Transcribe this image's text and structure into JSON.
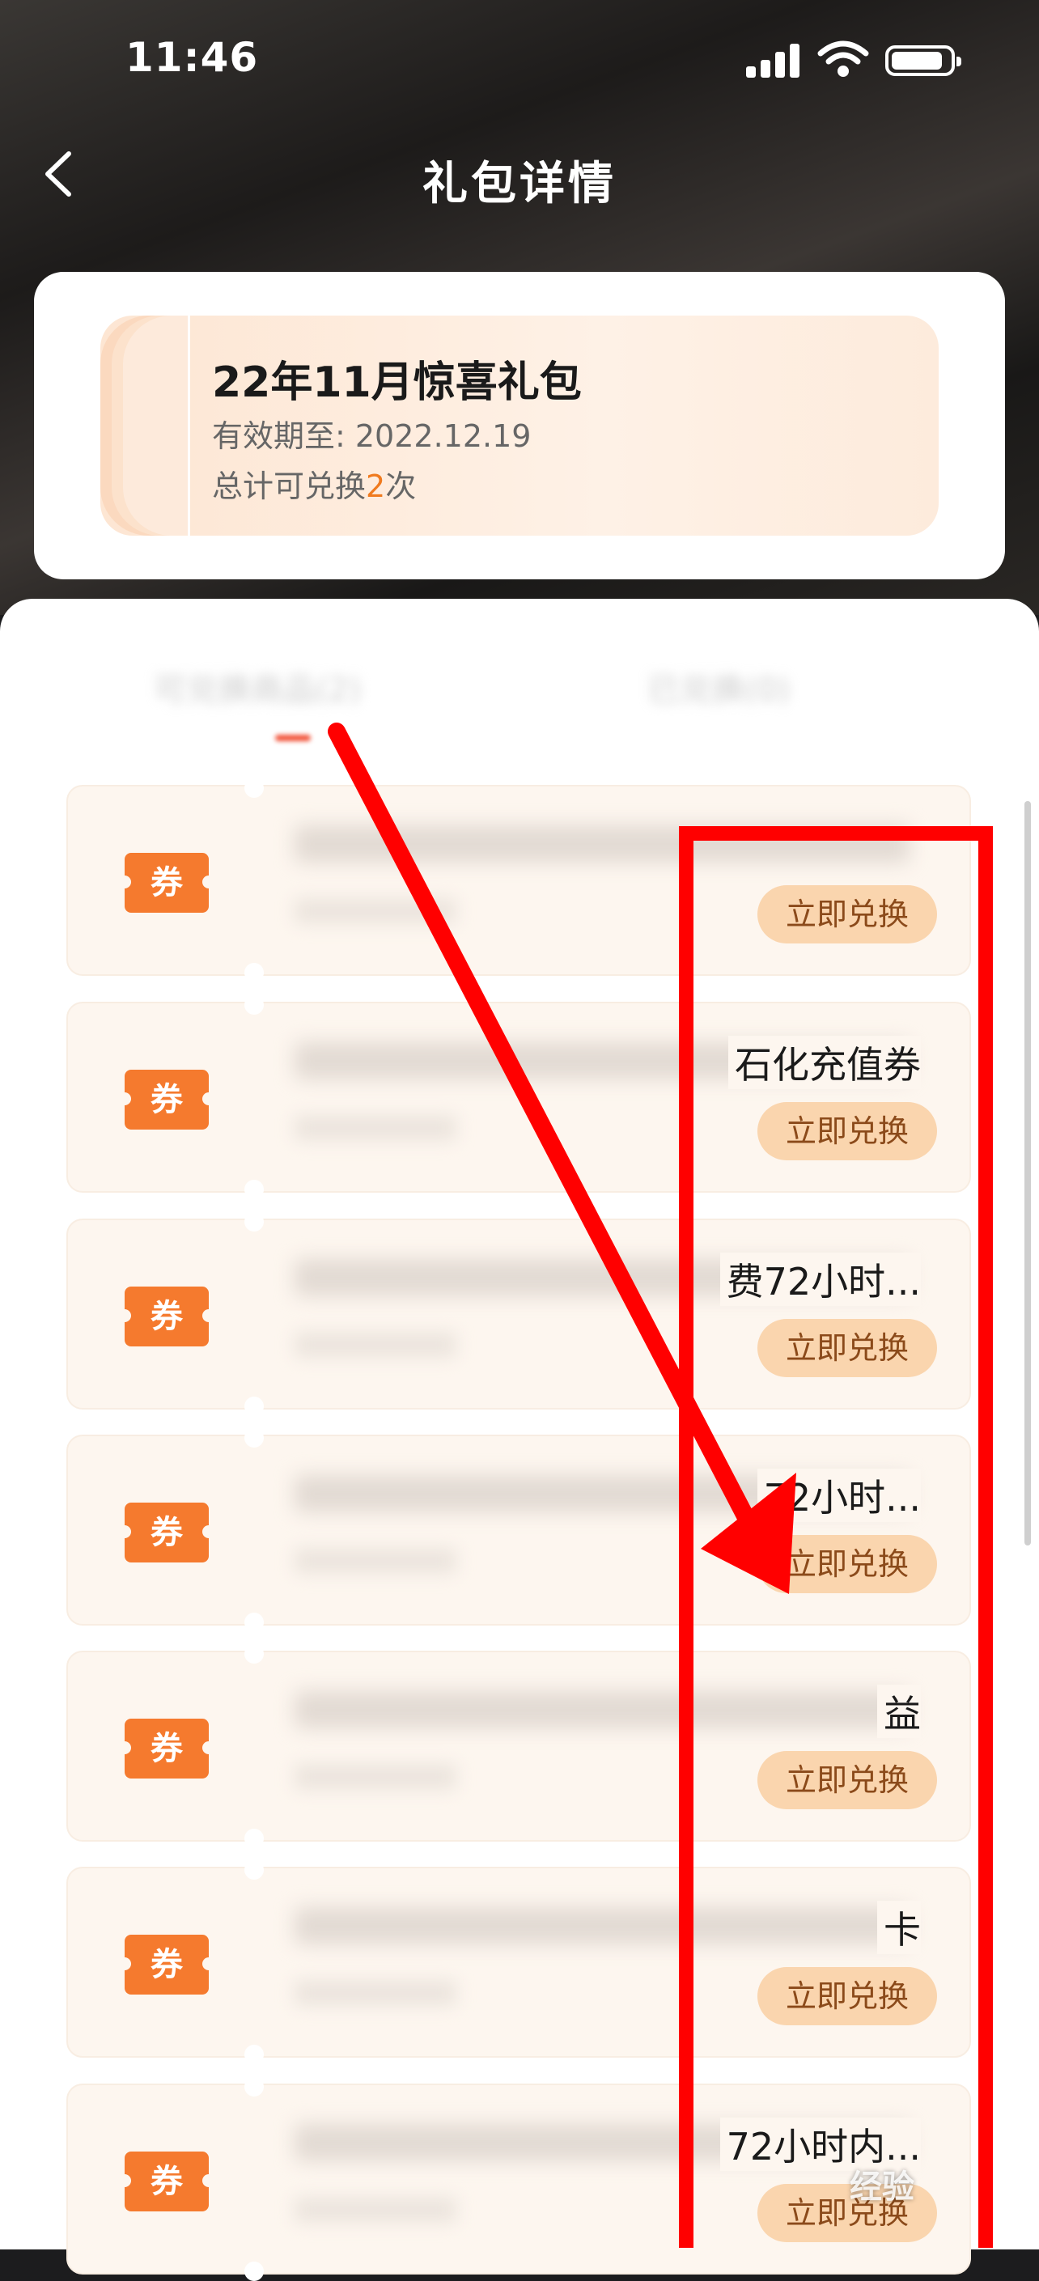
{
  "status_bar": {
    "time": "11:46",
    "icons": [
      "signal-icon",
      "wifi-icon",
      "battery-icon"
    ]
  },
  "navbar": {
    "title": "礼包详情",
    "back_icon": "chevron-left-icon"
  },
  "gift": {
    "name": "22年11月惊喜礼包",
    "valid_until": "有效期至: 2022.12.19",
    "total_prefix": "总计可兑换",
    "total_count": "2",
    "total_suffix": "次"
  },
  "coupons": [
    {
      "tag": "券",
      "visible_title": "",
      "button": "立即兑换"
    },
    {
      "tag": "券",
      "visible_title": "石化充值券",
      "button": "立即兑换"
    },
    {
      "tag": "券",
      "visible_title": "费72小时...",
      "button": "立即兑换"
    },
    {
      "tag": "券",
      "visible_title": "72小时...",
      "button": "立即兑换"
    },
    {
      "tag": "券",
      "visible_title": "益",
      "button": "立即兑换"
    },
    {
      "tag": "券",
      "visible_title": "卡",
      "button": "立即兑换"
    },
    {
      "tag": "券",
      "visible_title": "72小时内...",
      "button": "立即兑换"
    }
  ],
  "watermark": "经验",
  "colors": {
    "accent_orange": "#f57a2e",
    "button_bg": "#fad5ae",
    "annotation_red": "#ff0000"
  }
}
